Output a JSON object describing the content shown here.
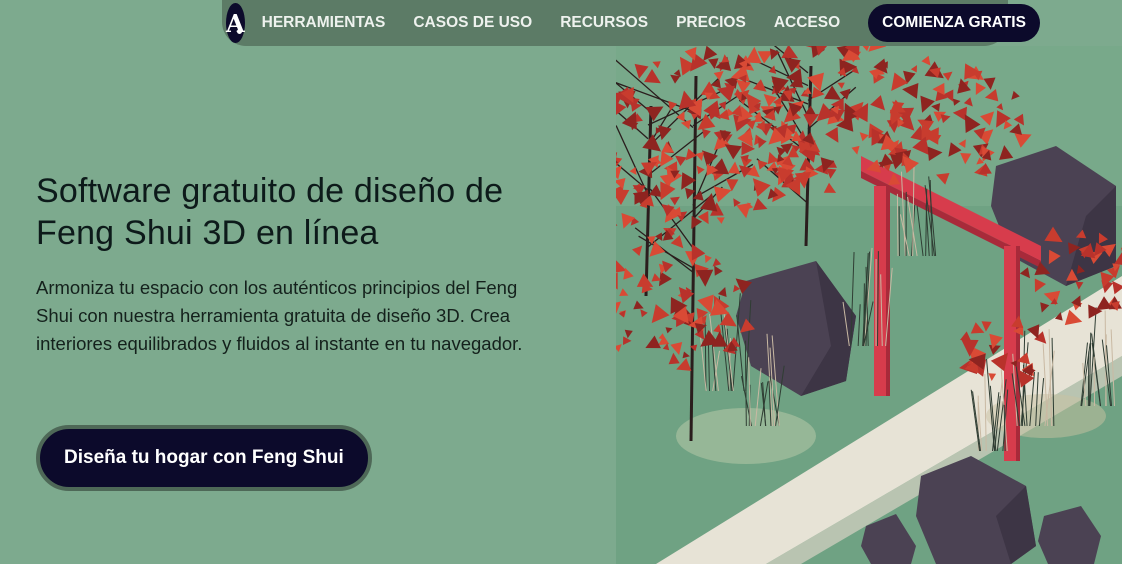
{
  "nav": {
    "logo_letter": "A",
    "links": [
      "HERRAMIENTAS",
      "CASOS DE USO",
      "RECURSOS",
      "PRECIOS",
      "ACCESO"
    ],
    "cta_label": "COMIENZA GRATIS"
  },
  "hero": {
    "title": "Software gratuito de diseño de Feng Shui 3D en línea",
    "description": "Armoniza tu espacio con los auténticos principios del Feng Shui con nuestra herramienta gratuita de diseño 3D. Crea interiores equilibrados y fluidos al instante en tu navegador.",
    "cta_label": "Diseña tu hogar con Feng Shui"
  },
  "illustration": {
    "icon": "zen-garden-illustration",
    "colors": {
      "ground": "#6fa283",
      "path": "#e7e3d6",
      "gate": "#d73c4c",
      "rock": "#4b4253",
      "leaves": "#b8322b",
      "grass": "#c9b9a3"
    }
  },
  "colors": {
    "background": "#7daa8e",
    "nav_background": "#5c7b66",
    "primary_dark": "#0c0a2b",
    "text": "#0d1a1a"
  }
}
